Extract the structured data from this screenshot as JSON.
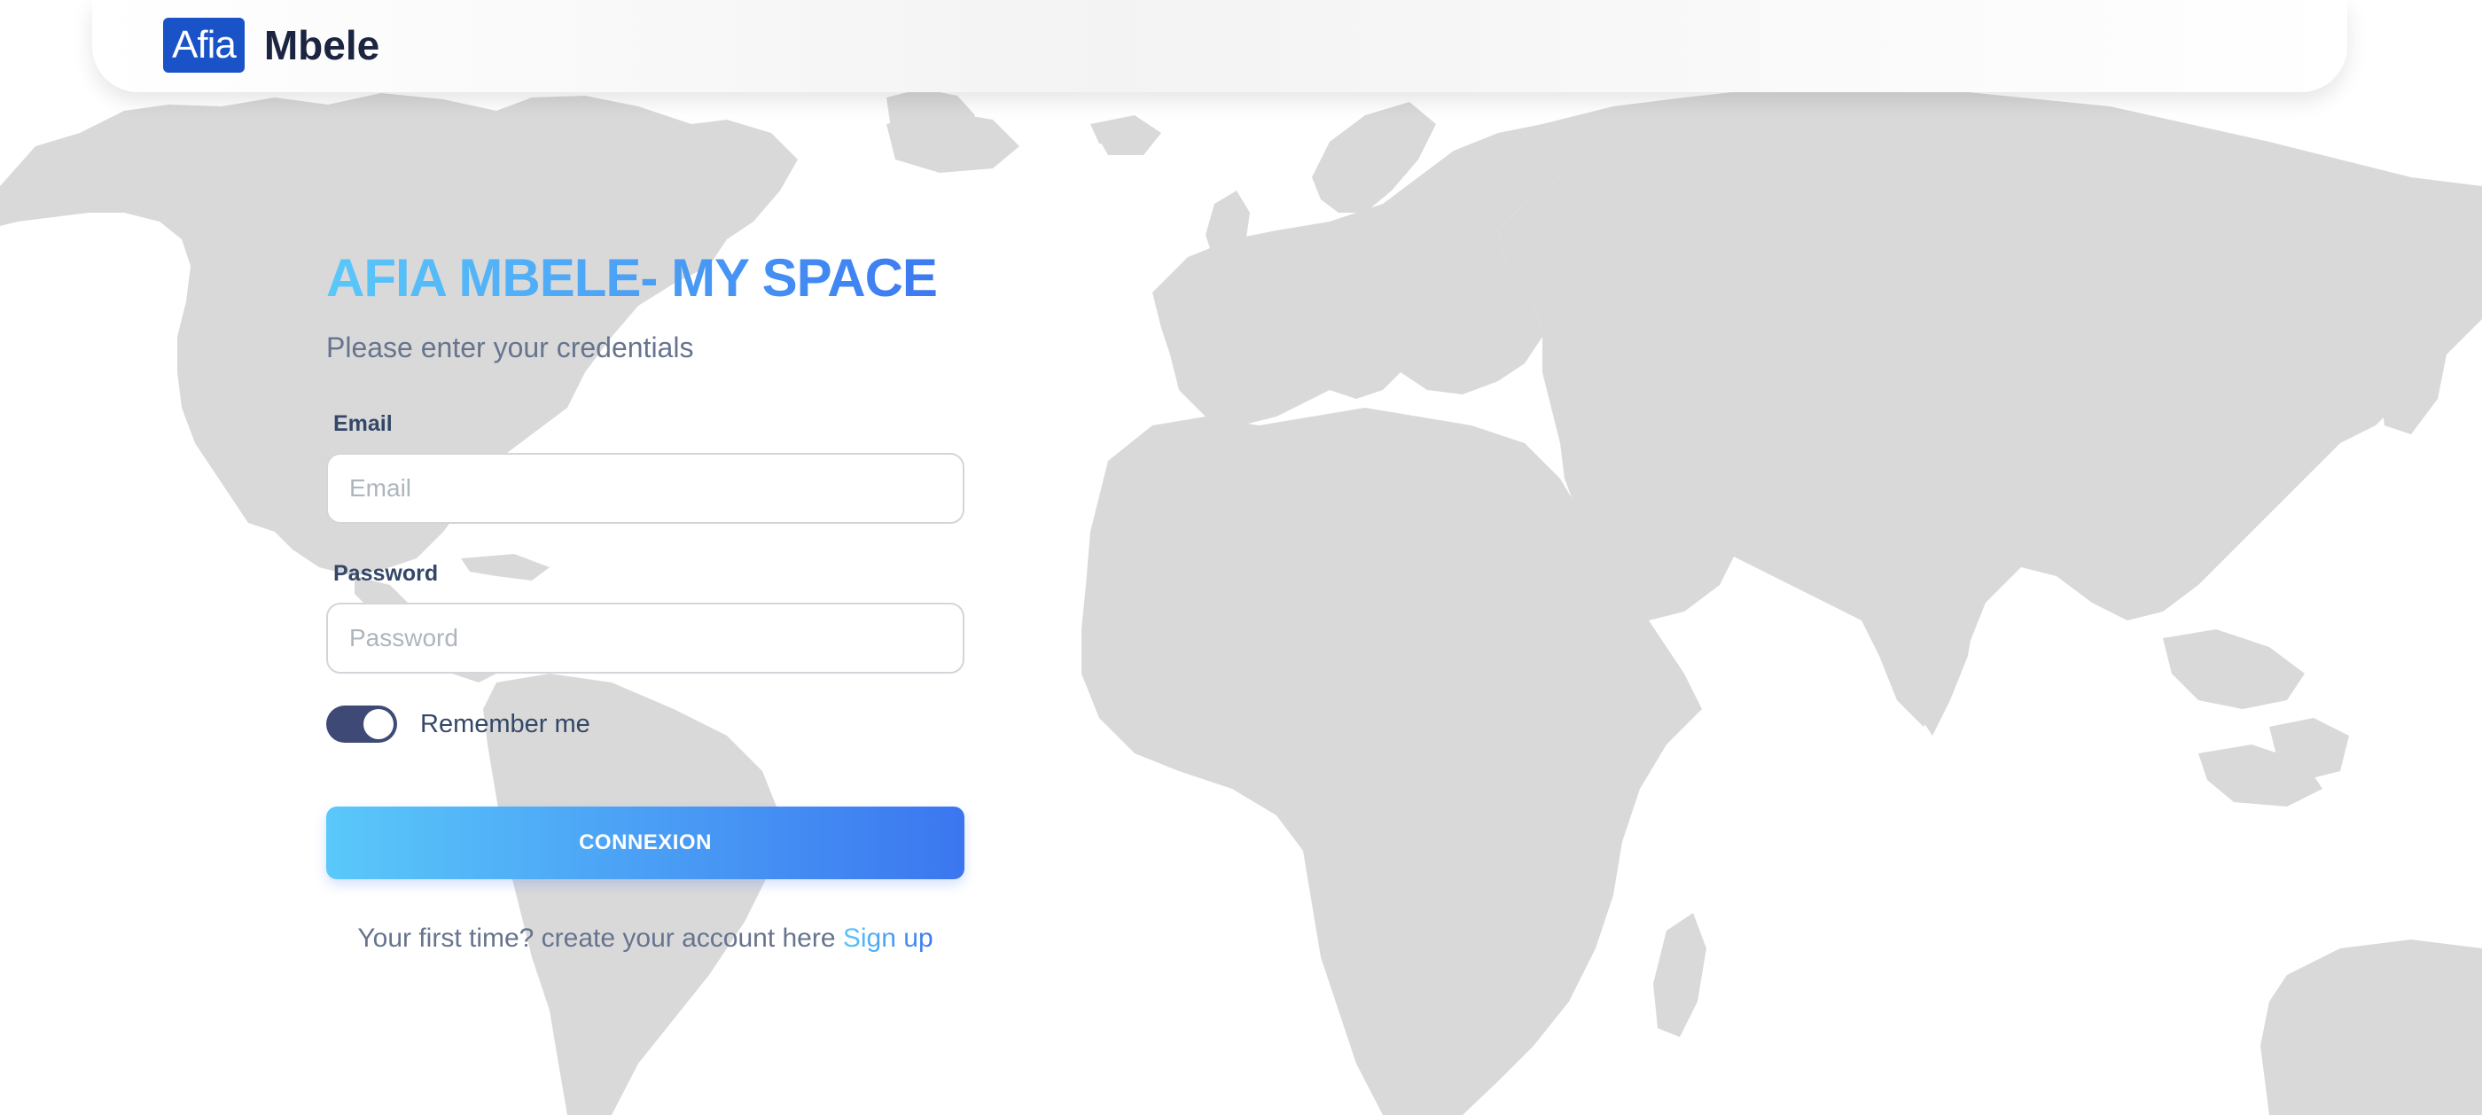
{
  "navbar": {
    "brand_badge": "Afia",
    "brand_name": "Mbele"
  },
  "login": {
    "title": "AFIA MBELE- MY SPACE",
    "subtitle": "Please enter your credentials",
    "email_label": "Email",
    "email_placeholder": "Email",
    "email_value": "",
    "password_label": "Password",
    "password_placeholder": "Password",
    "password_value": "",
    "remember_label": "Remember me",
    "remember_checked": true,
    "submit_label": "CONNEXION",
    "signup_prompt": "Your first time? create your account here",
    "signup_link": "Sign up"
  },
  "colors": {
    "brand_blue": "#1a52c8",
    "gradient_start": "#5ac8fa",
    "gradient_end": "#3b76f0",
    "toggle_on": "#3e4a75",
    "map_land": "#d9d9d9"
  },
  "icons": {
    "background": "world-map-icon"
  }
}
